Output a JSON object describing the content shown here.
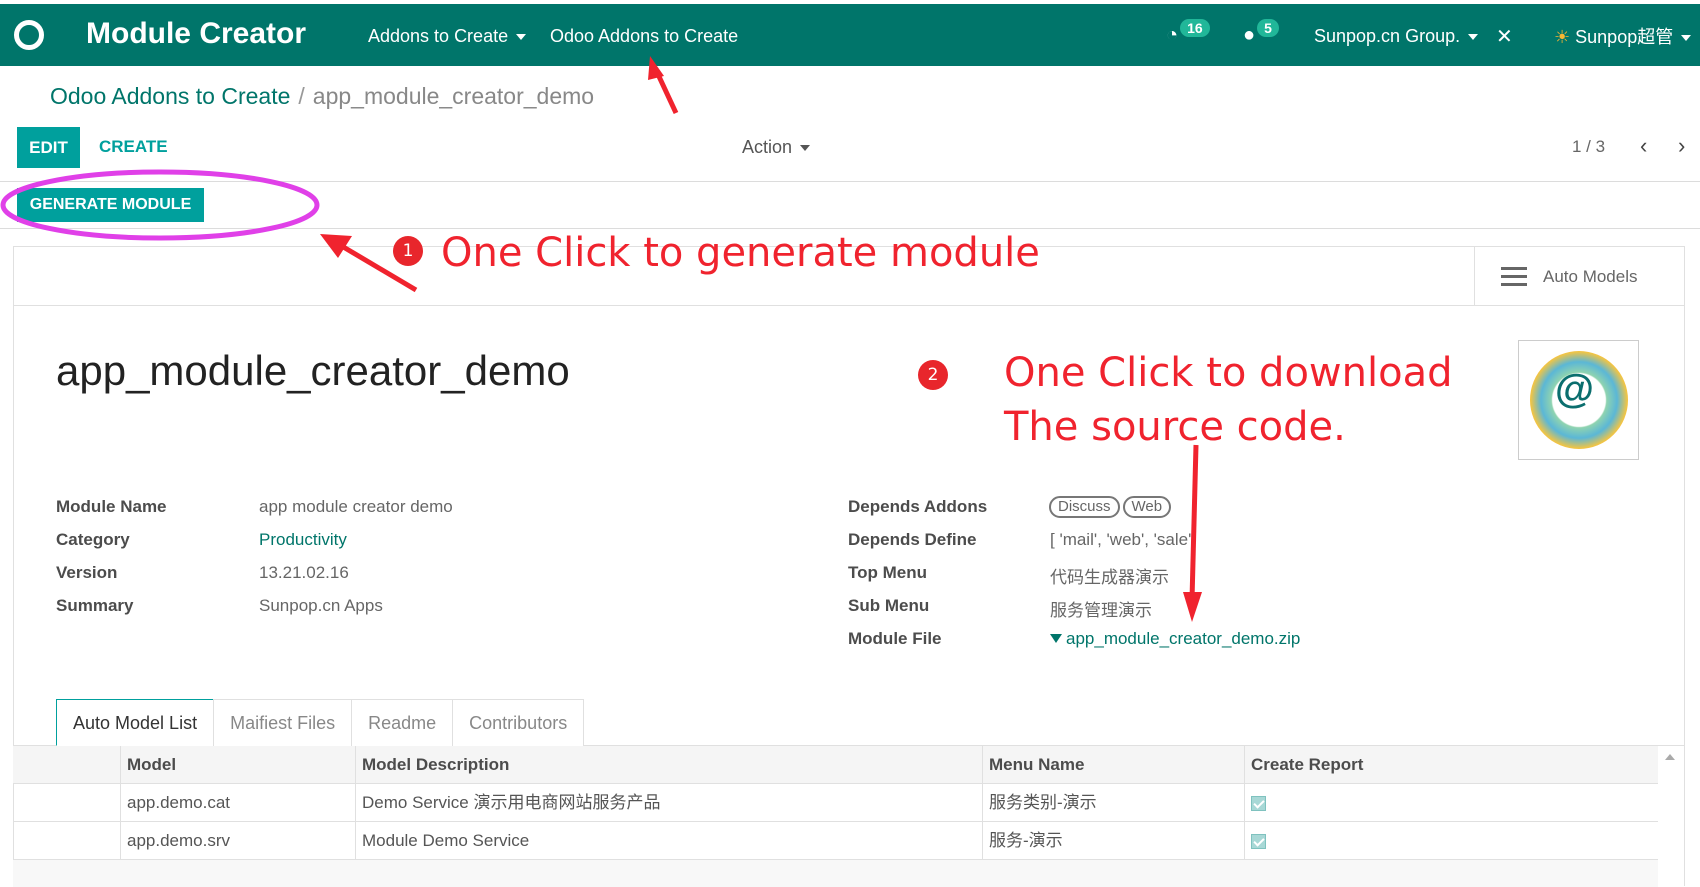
{
  "navbar": {
    "title": "Module Creator",
    "menus": [
      "Addons to Create",
      "Odoo Addons to Create"
    ],
    "activity_count": "16",
    "message_count": "5",
    "company": "Sunpop.cn Group.",
    "user": "Sunpop超管",
    "colors": {
      "bar": "#00756a",
      "accent": "#00a09d"
    }
  },
  "breadcrumb": {
    "parent": "Odoo Addons to Create",
    "separator": "/",
    "current": "app_module_creator_demo"
  },
  "controls": {
    "edit": "EDIT",
    "create": "CREATE",
    "action": "Action",
    "pager": "1 / 3",
    "prev": "‹",
    "next": "›"
  },
  "statusbar": {
    "generate": "GENERATE MODULE"
  },
  "smart_button": {
    "label": "Auto Models"
  },
  "record": {
    "title": "app_module_creator_demo"
  },
  "left_fields": [
    {
      "label": "Module Name",
      "value": "app module creator demo"
    },
    {
      "label": "Category",
      "value": "Productivity"
    },
    {
      "label": "Version",
      "value": "13.21.02.16"
    },
    {
      "label": "Summary",
      "value": "Sunpop.cn Apps"
    }
  ],
  "right_fields": {
    "depends_addons_label": "Depends Addons",
    "depends_addons": [
      "Discuss",
      "Web"
    ],
    "depends_define_label": "Depends Define",
    "depends_define": "[ 'mail', 'web', 'sale'",
    "top_menu_label": "Top Menu",
    "top_menu": "代码生成器演示",
    "sub_menu_label": "Sub Menu",
    "sub_menu": "服务管理演示",
    "module_file_label": "Module File",
    "module_file": "app_module_creator_demo.zip"
  },
  "tabs": [
    "Auto Model List",
    "Maifiest Files",
    "Readme",
    "Contributors"
  ],
  "table": {
    "headers": [
      "Model",
      "Model Description",
      "Menu Name",
      "Create Report"
    ],
    "rows": [
      {
        "model": "app.demo.cat",
        "description": "Demo Service 演示用电商网站服务产品",
        "menu": "服务类别-演示",
        "report": true
      },
      {
        "model": "app.demo.srv",
        "description": "Module Demo Service",
        "menu": "服务-演示",
        "report": true
      }
    ]
  },
  "annotations": {
    "step1": "1",
    "text1": "One Click to generate module",
    "step2": "2",
    "text2_line1": "One Click to download",
    "text2_line2": "The source code.",
    "color": "#f0232e",
    "ellipse_color": "#e040e8"
  }
}
